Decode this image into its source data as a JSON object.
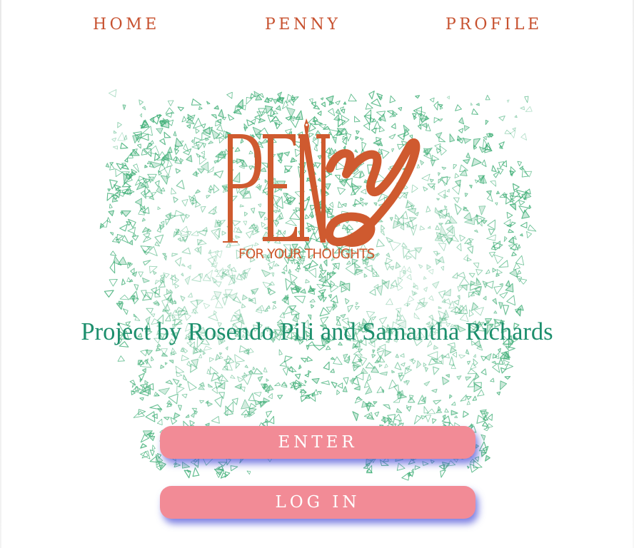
{
  "nav": {
    "home": "HOME",
    "penny": "PENNY",
    "profile": "PROFILE"
  },
  "logo": {
    "wordmark": "PENNY",
    "tagline": "FOR YOUR THOUGHTS"
  },
  "subtitle": "Project by Rosendo Pili and Samantha Richards",
  "buttons": {
    "enter": "ENTER",
    "login": "LOG IN"
  },
  "colors": {
    "accent": "#c7512f",
    "logo": "#cf5a2f",
    "subtitle": "#1d8f6d",
    "art": "#3fae76",
    "button": "#f28b96",
    "button_shadow": "#5458d8"
  }
}
